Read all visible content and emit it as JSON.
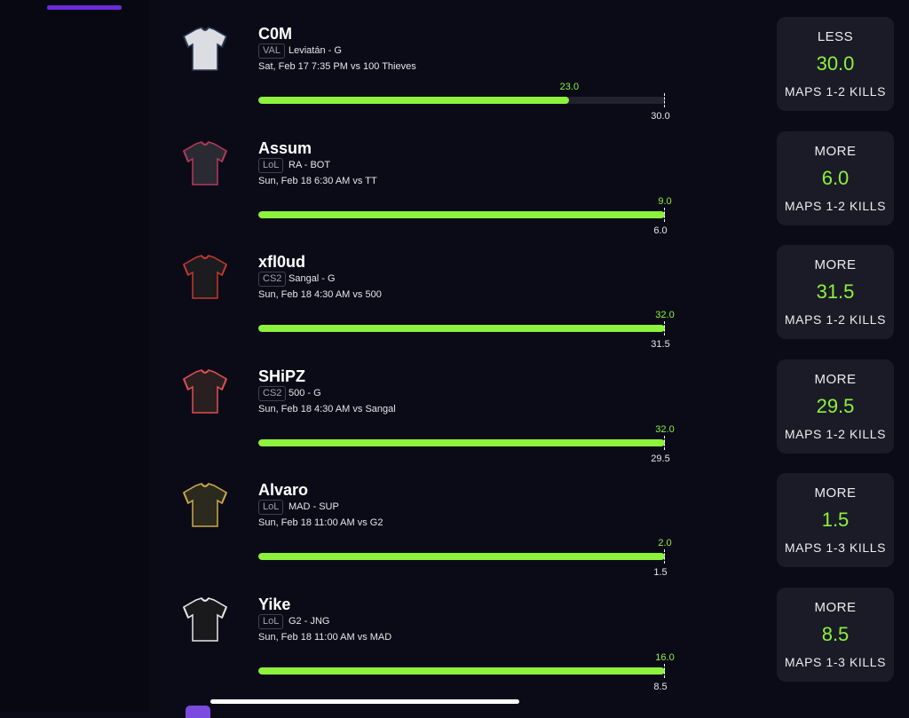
{
  "colors": {
    "accent": "#8cf23c",
    "card": "#1b1b27",
    "background": "#0b0b18",
    "brand": "#6a2bd9"
  },
  "picks": [
    {
      "player": "C0M",
      "game": "VAL",
      "team_pos": "Leviatán - G",
      "match": "Sat, Feb 17 7:35 PM  vs 100 Thieves",
      "projection": "23.0",
      "line_value": "30.0",
      "fill_fraction": 0.765,
      "bet": {
        "direction": "LESS",
        "value": "30.0",
        "stat": "MAPS 1-2 KILLS"
      },
      "jersey": {
        "body": "#dcdde2",
        "trim": "#2d3a52",
        "icon": "jersey-icon"
      }
    },
    {
      "player": "Assum",
      "game": "LoL",
      "team_pos": "RA - BOT",
      "match": "Sun, Feb 18 6:30 AM  vs TT",
      "projection": "9.0",
      "line_value": "6.0",
      "fill_fraction": 1.0,
      "bet": {
        "direction": "MORE",
        "value": "6.0",
        "stat": "MAPS 1-2 KILLS"
      },
      "jersey": {
        "body": "#2a2a33",
        "trim": "#b23a5a",
        "icon": "jersey-icon"
      }
    },
    {
      "player": "xfl0ud",
      "game": "CS2",
      "team_pos": "Sangal - G",
      "match": "Sun, Feb 18 4:30 AM  vs 500",
      "projection": "32.0",
      "line_value": "31.5",
      "fill_fraction": 1.0,
      "bet": {
        "direction": "MORE",
        "value": "31.5",
        "stat": "MAPS 1-2 KILLS"
      },
      "jersey": {
        "body": "#1c1c20",
        "trim": "#c0392b",
        "icon": "jersey-icon"
      }
    },
    {
      "player": "SHiPZ",
      "game": "CS2",
      "team_pos": "500 - G",
      "match": "Sun, Feb 18 4:30 AM  vs Sangal",
      "projection": "32.0",
      "line_value": "29.5",
      "fill_fraction": 1.0,
      "bet": {
        "direction": "MORE",
        "value": "29.5",
        "stat": "MAPS 1-2 KILLS"
      },
      "jersey": {
        "body": "#2a1f20",
        "trim": "#e05050",
        "icon": "jersey-icon"
      }
    },
    {
      "player": "Alvaro",
      "game": "LoL",
      "team_pos": "MAD - SUP",
      "match": "Sun, Feb 18 11:00 AM  vs G2",
      "projection": "2.0",
      "line_value": "1.5",
      "fill_fraction": 1.0,
      "bet": {
        "direction": "MORE",
        "value": "1.5",
        "stat": "MAPS 1-3 KILLS"
      },
      "jersey": {
        "body": "#2a2a1e",
        "trim": "#c9a94a",
        "icon": "jersey-icon"
      }
    },
    {
      "player": "Yike",
      "game": "LoL",
      "team_pos": "G2 - JNG",
      "match": "Sun, Feb 18 11:00 AM  vs MAD",
      "projection": "16.0",
      "line_value": "8.5",
      "fill_fraction": 1.0,
      "bet": {
        "direction": "MORE",
        "value": "8.5",
        "stat": "MAPS 1-3 KILLS"
      },
      "jersey": {
        "body": "#1a1a1c",
        "trim": "#e8e8e8",
        "icon": "jersey-icon"
      }
    }
  ]
}
